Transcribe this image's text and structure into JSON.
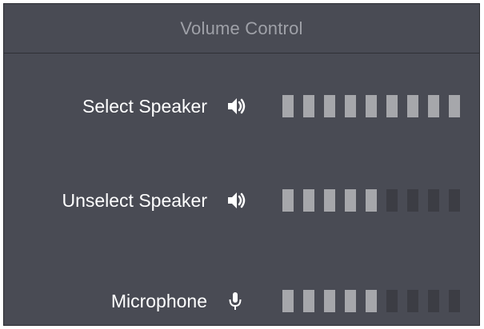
{
  "window": {
    "title": "Volume Control"
  },
  "rows": [
    {
      "label": "Select Speaker",
      "icon": "speaker-icon",
      "level_segments": 9,
      "total_segments": 9
    },
    {
      "label": "Unselect Speaker",
      "icon": "speaker-icon",
      "level_segments": 5,
      "total_segments": 9
    },
    {
      "label": "Microphone",
      "icon": "microphone-icon",
      "level_segments": 5,
      "total_segments": 9
    }
  ],
  "colors": {
    "background": "#494b54",
    "segment_on": "#a6a7ab",
    "segment_off": "#3c3d44",
    "title_text": "#9fa1a8",
    "label_text": "#ffffff"
  }
}
